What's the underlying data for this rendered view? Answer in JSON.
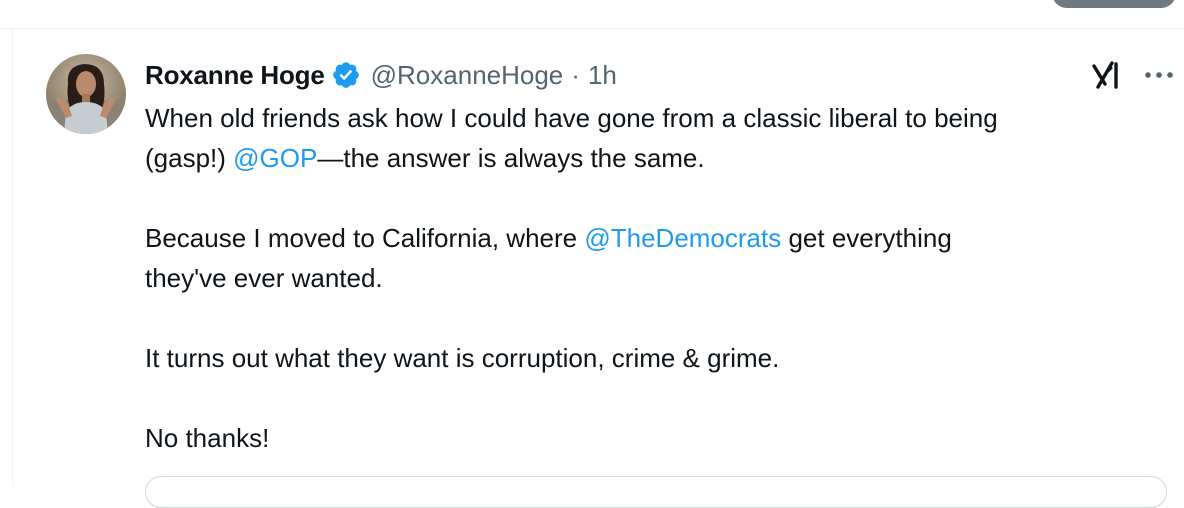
{
  "tweet": {
    "author_name": "Roxanne Hoge",
    "handle": "@RoxanneHoge",
    "separator": "·",
    "time": "1h",
    "verified": true,
    "line1_text": "When old friends ask how I could have gone from a classic liberal to being",
    "line2_pre": "(gasp!) ",
    "mention_gop": "@GOP",
    "line2_post": "—the answer is always the same.",
    "line3_pre": "Because I moved to California, where ",
    "mention_democrats": "@TheDemocrats",
    "line3_post": " get everything",
    "line4_text": "they've ever wanted.",
    "line5_text": "It turns out what they want is corruption, crime & grime.",
    "line6_text": "No thanks!"
  },
  "icons": {
    "verified": "verified-badge-icon",
    "grok": "grok-icon",
    "more": "more-options-icon"
  },
  "colors": {
    "link": "#1d9bf0",
    "verified": "#1d9bf0",
    "secondary_text": "#536471",
    "primary_text": "#0f1419"
  }
}
